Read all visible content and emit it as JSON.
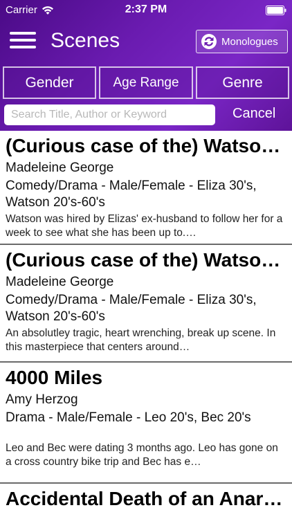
{
  "status_bar": {
    "carrier": "Carrier",
    "time": "2:37 PM"
  },
  "nav": {
    "title": "Scenes",
    "monologues_label": "Monologues"
  },
  "filters": {
    "gender": "Gender",
    "age_range": "Age Range",
    "genre": "Genre"
  },
  "search": {
    "placeholder": "Search Title, Author or Keyword",
    "value": "",
    "cancel_label": "Cancel"
  },
  "scenes": [
    {
      "title": "(Curious case of the) Watson Intelligence",
      "author": "Madeleine George",
      "meta": "Comedy/Drama - Male/Female - Eliza 30's, Watson 20's-60's",
      "description": "Watson was hired by Elizas' ex-husband to follow her for a week to see what she has been up to.…"
    },
    {
      "title": "(Curious case of the) Watson Intelligence",
      "author": "Madeleine George",
      "meta": "Comedy/Drama - Male/Female - Eliza 30's, Watson 20's-60's",
      "description": "An absolutley tragic, heart wrenching, break up scene.  In this masterpiece that centers around…"
    },
    {
      "title": "4000 Miles",
      "author": "Amy Herzog",
      "meta": "Drama - Male/Female - Leo 20's, Bec 20's",
      "description": "Leo and Bec were dating 3 months ago. Leo has gone on a cross country bike trip and Bec has e…"
    },
    {
      "title": "Accidental Death of an Anarchist"
    }
  ],
  "colors": {
    "header_gradient_start": "#4a0a86",
    "header_gradient_mid": "#7a26c6",
    "divider": "#6a6a6a"
  }
}
